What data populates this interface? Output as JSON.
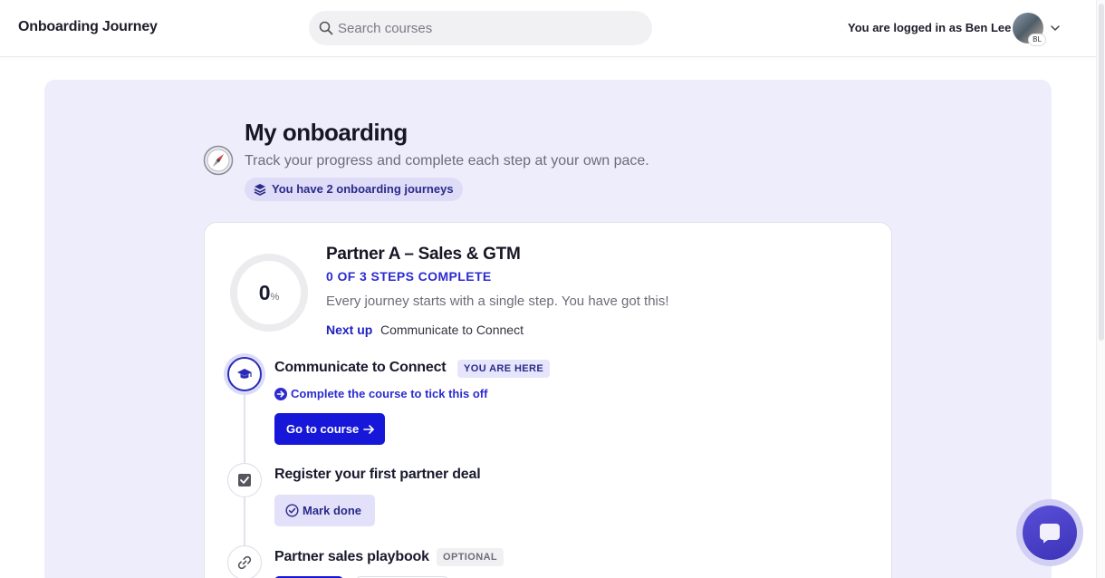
{
  "header": {
    "brand": "Onboarding Journey",
    "search_placeholder": "Search courses",
    "logged_in_text": "You are logged in as Ben Lee",
    "avatar_initials": "BL"
  },
  "page": {
    "title": "My onboarding",
    "subtitle": "Track your progress and complete each step at your own pace.",
    "journeys_badge": "You have 2 onboarding journeys"
  },
  "journey": {
    "title": "Partner A – Sales & GTM",
    "progress_percent": 0,
    "progress_value": "0",
    "progress_unit": "%",
    "steps_complete": "0 OF 3 STEPS COMPLETE",
    "encouragement": "Every journey starts with a single step. You have got this!",
    "next_up_label": "Next up",
    "next_up_step": "Communicate to Connect",
    "steps": [
      {
        "title": "Communicate to Connect",
        "tag": "YOU ARE HERE",
        "hint": "Complete the course to tick this off",
        "action_label": "Go to course"
      },
      {
        "title": "Register your first partner deal",
        "action_label": "Mark done"
      },
      {
        "title": "Partner sales playbook",
        "tag": "OPTIONAL"
      }
    ]
  },
  "colors": {
    "accent": "#1717d9",
    "accent_text": "#2d2bd0",
    "panel_bg": "#eeedfc",
    "badge_bg": "#dfdcf8",
    "chat_fab": "#4a41c9"
  }
}
